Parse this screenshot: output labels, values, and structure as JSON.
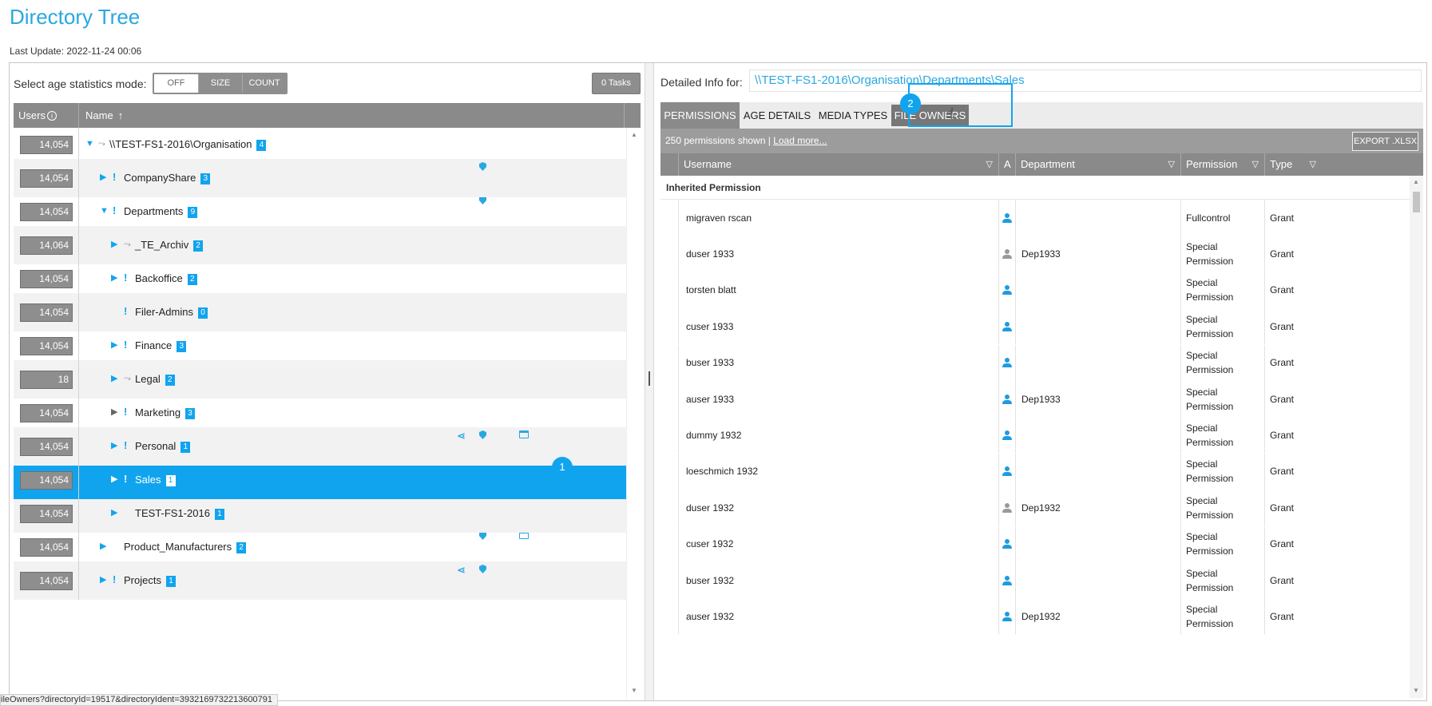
{
  "page": {
    "title": "Directory Tree",
    "last_update": "Last Update: 2022-11-24 00:06",
    "status_url": "ileOwners?directoryId=19517&directoryIdent=3932169732213600791"
  },
  "left": {
    "age_mode_label": "Select age statistics mode:",
    "age_mode_options": [
      "OFF",
      "SIZE",
      "COUNT"
    ],
    "age_mode_selected": "OFF",
    "tasks_label": "0 Tasks",
    "columns": {
      "users": "Users",
      "name": "Name"
    },
    "selected_marker": "1",
    "rows": [
      {
        "users": "14,054",
        "name": "\\\\TEST-FS1-2016\\Organisation",
        "count": "4",
        "level": 0,
        "expander": "expanded",
        "flag": "link",
        "icons": []
      },
      {
        "users": "14,054",
        "name": "CompanyShare",
        "count": "3",
        "level": 1,
        "expander": "collapsed",
        "flag": "warn",
        "icons": [
          "shield-icon"
        ]
      },
      {
        "users": "14,054",
        "name": "Departments",
        "count": "9",
        "level": 1,
        "expander": "expanded",
        "flag": "warn",
        "icons": [
          "shield-icon"
        ]
      },
      {
        "users": "14,064",
        "name": "_TE_Archiv",
        "count": "2",
        "level": 2,
        "expander": "collapsed",
        "flag": "link",
        "icons": []
      },
      {
        "users": "14,054",
        "name": "Backoffice",
        "count": "2",
        "level": 2,
        "expander": "collapsed",
        "flag": "warn",
        "icons": []
      },
      {
        "users": "14,054",
        "name": "Filer-Admins",
        "count": "0",
        "level": 2,
        "expander": "none",
        "flag": "warn",
        "icons": []
      },
      {
        "users": "14,054",
        "name": "Finance",
        "count": "3",
        "level": 2,
        "expander": "collapsed",
        "flag": "warn",
        "icons": []
      },
      {
        "users": "18",
        "name": "Legal",
        "count": "2",
        "level": 2,
        "expander": "collapsed",
        "flag": "link",
        "icons": []
      },
      {
        "users": "14,054",
        "name": "Marketing",
        "count": "3",
        "level": 2,
        "expander": "collapsed-gray",
        "flag": "warn",
        "icons": []
      },
      {
        "users": "14,054",
        "name": "Personal",
        "count": "1",
        "level": 2,
        "expander": "collapsed",
        "flag": "warn",
        "icons": [
          "share-icon",
          "shield-icon",
          "calendar-icon"
        ]
      },
      {
        "users": "14,054",
        "name": "Sales",
        "count": "1",
        "level": 2,
        "expander": "collapsed",
        "flag": "warn",
        "icons": [],
        "selected": true
      },
      {
        "users": "14,054",
        "name": "TEST-FS1-2016",
        "count": "1",
        "level": 2,
        "expander": "collapsed",
        "flag": "none",
        "icons": []
      },
      {
        "users": "14,054",
        "name": "Product_Manufacturers",
        "count": "2",
        "level": 1,
        "expander": "collapsed",
        "flag": "none",
        "icons": [
          "shield-icon",
          "calendar-icon"
        ]
      },
      {
        "users": "14,054",
        "name": "Projects",
        "count": "1",
        "level": 1,
        "expander": "collapsed",
        "flag": "warn",
        "icons": [
          "share-icon",
          "shield-icon"
        ]
      }
    ]
  },
  "right": {
    "detail_label": "Detailed Info for:",
    "detail_path": "\\\\TEST-FS1-2016\\Organisation\\Departments\\Sales",
    "tabs": [
      "PERMISSIONS",
      "AGE DETAILS",
      "MEDIA TYPES",
      "FILE OWNERS"
    ],
    "active_tab": "PERMISSIONS",
    "hover_tab": "FILE OWNERS",
    "tab_marker": "2",
    "perm_count": "250 permissions shown | ",
    "load_more": "Load more...",
    "export_label": "EXPORT .XLSX",
    "columns": [
      "Username",
      "A",
      "Department",
      "Permission",
      "Type"
    ],
    "group_label": "Inherited Permission",
    "rows": [
      {
        "user": "migraven rscan",
        "icon": "blue",
        "dept": "",
        "perm": "Fullcontrol",
        "type": "Grant"
      },
      {
        "user": "duser 1933",
        "icon": "gray",
        "dept": "Dep1933",
        "perm": "Special Permission",
        "type": "Grant"
      },
      {
        "user": "torsten blatt",
        "icon": "blue",
        "dept": "",
        "perm": "Special Permission",
        "type": "Grant"
      },
      {
        "user": "cuser 1933",
        "icon": "blue",
        "dept": "",
        "perm": "Special Permission",
        "type": "Grant"
      },
      {
        "user": "buser 1933",
        "icon": "blue",
        "dept": "",
        "perm": "Special Permission",
        "type": "Grant"
      },
      {
        "user": "auser 1933",
        "icon": "blue",
        "dept": "Dep1933",
        "perm": "Special Permission",
        "type": "Grant"
      },
      {
        "user": "dummy 1932",
        "icon": "blue",
        "dept": "",
        "perm": "Special Permission",
        "type": "Grant"
      },
      {
        "user": "loeschmich 1932",
        "icon": "blue",
        "dept": "",
        "perm": "Special Permission",
        "type": "Grant"
      },
      {
        "user": "duser 1932",
        "icon": "gray",
        "dept": "Dep1932",
        "perm": "Special Permission",
        "type": "Grant"
      },
      {
        "user": "cuser 1932",
        "icon": "blue",
        "dept": "",
        "perm": "Special Permission",
        "type": "Grant"
      },
      {
        "user": "buser 1932",
        "icon": "blue",
        "dept": "",
        "perm": "Special Permission",
        "type": "Grant"
      },
      {
        "user": "auser 1932",
        "icon": "blue",
        "dept": "Dep1932",
        "perm": "Special Permission",
        "type": "Grant"
      }
    ]
  },
  "colors": {
    "accent": "#11a4ee",
    "title": "#29a8e0",
    "header_gray": "#8a8a8a",
    "person_blue": "#1e9be0",
    "person_gray": "#9a9a9a"
  }
}
